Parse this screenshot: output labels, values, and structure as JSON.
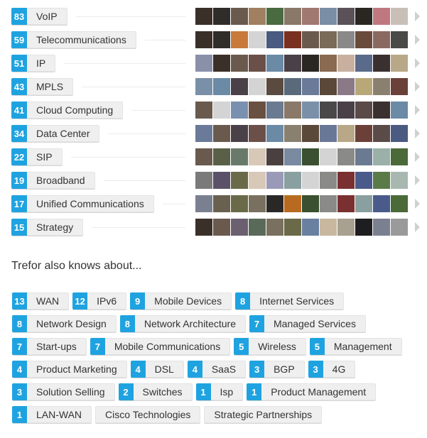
{
  "top_skills": [
    {
      "count": "83",
      "name": "VoIP",
      "avatars": [
        "#3b3029",
        "#2f2c2a",
        "#6a5a4e",
        "#a08060",
        "#4a6a40",
        "#8a7868",
        "#a07870",
        "#7a8ea6",
        "#5a5258",
        "#2a2622",
        "#c07880",
        "#c8c0b8"
      ]
    },
    {
      "count": "59",
      "name": "Telecommunications",
      "avatars": [
        "#3b3029",
        "#2f2c2a",
        "#c87a3a",
        "#d4d4d4",
        "#4a5a80",
        "#7a3020",
        "#6a5a4e",
        "#7a6a58",
        "#8a8888",
        "#6a4a3a",
        "#8a6a60",
        "#4a4a48"
      ]
    },
    {
      "count": "51",
      "name": "IP",
      "avatars": [
        "#8a90a8",
        "#3b3029",
        "#6a5a4e",
        "#6a5048",
        "#6a8aa6",
        "#4a4048",
        "#2a2622",
        "#8a6a50",
        "#c8b0a0",
        "#5a6a8a",
        "#3a3030",
        "#b8a888"
      ]
    },
    {
      "count": "43",
      "name": "MPLS",
      "avatars": [
        "#7a90a8",
        "#6a8aa6",
        "#4a4048",
        "#d4d4d4",
        "#5a4a40",
        "#5a6a7a",
        "#6a7a98",
        "#5a4838",
        "#8a7a88",
        "#b8a878",
        "#8a8070",
        "#6a4038"
      ]
    },
    {
      "count": "41",
      "name": "Cloud Computing",
      "avatars": [
        "#6a5a4e",
        "#d4d4d4",
        "#7a90b0",
        "#6a5040",
        "#6a7a90",
        "#8a7868",
        "#7a90a8",
        "#4a4848",
        "#4a4048",
        "#5a4a48",
        "#3a3030",
        "#6a8aa6"
      ]
    },
    {
      "count": "34",
      "name": "Data Center",
      "avatars": [
        "#6a7a98",
        "#6a5a4e",
        "#4a4048",
        "#6a5048",
        "#6a8aa6",
        "#8a8070",
        "#5a4838",
        "#6a7898",
        "#b8a888",
        "#6a4038",
        "#5a4a48",
        "#4a5a80"
      ]
    },
    {
      "count": "22",
      "name": "SIP",
      "avatars": [
        "#6a5a4e",
        "#5a6048",
        "#6a7a6a",
        "#d8c8b8",
        "#4a4040",
        "#7a8aa0",
        "#3a5030",
        "#d4d4d4",
        "#8a8a88",
        "#6a7a90",
        "#9ab0a8",
        "#4a6a38"
      ]
    },
    {
      "count": "19",
      "name": "Broadband",
      "avatars": [
        "#7a7a7a",
        "#5a5068",
        "#6a6a48",
        "#d8c8b8",
        "#9a9ab8",
        "#8aa0a0",
        "#d4d4d4",
        "#8a8a88",
        "#7a3030",
        "#4a5a8a",
        "#5a7a48",
        "#a8b8b0"
      ]
    },
    {
      "count": "17",
      "name": "Unified Communications",
      "avatars": [
        "#7a8090",
        "#6a6050",
        "#6a6a48",
        "#7a7060",
        "#2a2826",
        "#b86a20",
        "#3a5030",
        "#8a8a88",
        "#7a3030",
        "#8aa0a0",
        "#4a5a8a",
        "#4a6a38"
      ]
    },
    {
      "count": "15",
      "name": "Strategy",
      "avatars": [
        "#3b3029",
        "#6a5a4e",
        "#6a6070",
        "#5a6a5a",
        "#7a7060",
        "#6a6a48",
        "#6a80a0",
        "#c8b8a0",
        "#a8a090",
        "#1e1e20",
        "#7a8090",
        "#9a9a9a"
      ]
    }
  ],
  "also_knows": {
    "title": "Trefor also knows about...",
    "skills": [
      {
        "count": "13",
        "name": "WAN"
      },
      {
        "count": "12",
        "name": "IPv6"
      },
      {
        "count": "9",
        "name": "Mobile Devices"
      },
      {
        "count": "8",
        "name": "Internet Services"
      },
      {
        "count": "8",
        "name": "Network Design"
      },
      {
        "count": "8",
        "name": "Network Architecture"
      },
      {
        "count": "7",
        "name": "Managed Services"
      },
      {
        "count": "7",
        "name": "Start-ups"
      },
      {
        "count": "7",
        "name": "Mobile Communications"
      },
      {
        "count": "5",
        "name": "Wireless"
      },
      {
        "count": "5",
        "name": "Management"
      },
      {
        "count": "4",
        "name": "Product Marketing"
      },
      {
        "count": "4",
        "name": "DSL"
      },
      {
        "count": "4",
        "name": "SaaS"
      },
      {
        "count": "3",
        "name": "BGP"
      },
      {
        "count": "3",
        "name": "4G"
      },
      {
        "count": "3",
        "name": "Solution Selling"
      },
      {
        "count": "2",
        "name": "Switches"
      },
      {
        "count": "1",
        "name": "Isp"
      },
      {
        "count": "1",
        "name": "Product Management"
      },
      {
        "count": "1",
        "name": "LAN-WAN"
      },
      {
        "count": "",
        "name": "Cisco Technologies"
      },
      {
        "count": "",
        "name": "Strategic Partnerships"
      }
    ]
  },
  "colors": {
    "badge": "#1fa3e0",
    "pill": "#efefef"
  }
}
